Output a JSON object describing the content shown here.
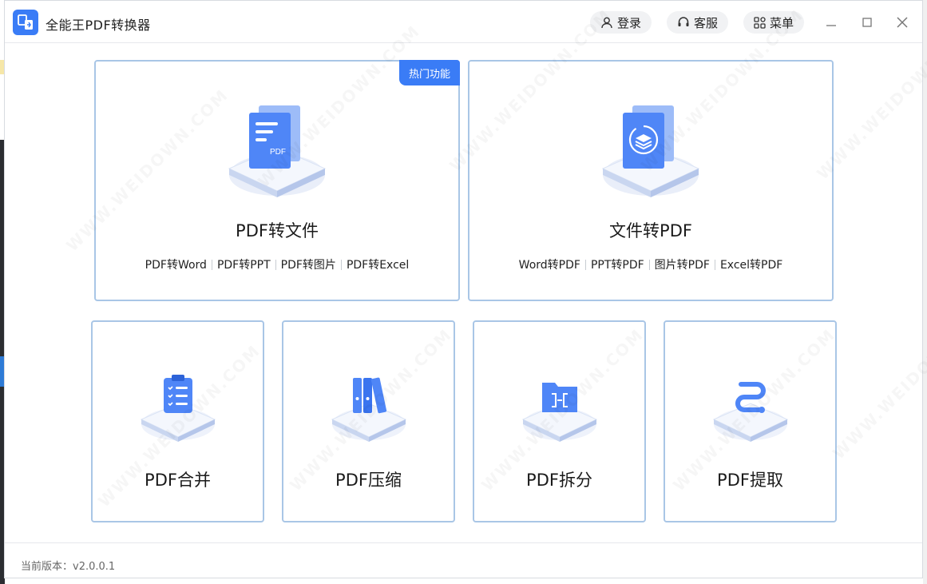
{
  "app": {
    "title": "全能王PDF转换器",
    "logo_icon": "convert-icon"
  },
  "header": {
    "login_label": "登录",
    "service_label": "客服",
    "menu_label": "菜单"
  },
  "cards": {
    "pdf_to_file": {
      "badge": "热门功能",
      "title": "PDF转文件",
      "links": [
        "PDF转Word",
        "PDF转PPT",
        "PDF转图片",
        "PDF转Excel"
      ]
    },
    "file_to_pdf": {
      "title": "文件转PDF",
      "links": [
        "Word转PDF",
        "PPT转PDF",
        "图片转PDF",
        "Excel转PDF"
      ]
    },
    "merge": {
      "title": "PDF合并"
    },
    "compress": {
      "title": "PDF压缩"
    },
    "split": {
      "title": "PDF拆分"
    },
    "extract": {
      "title": "PDF提取"
    }
  },
  "footer": {
    "version": "当前版本：v2.0.0.1"
  },
  "watermark": "WWW.WEIDOWN.COM",
  "colors": {
    "accent": "#3a7cf6",
    "card_border": "#a9c6e6"
  }
}
